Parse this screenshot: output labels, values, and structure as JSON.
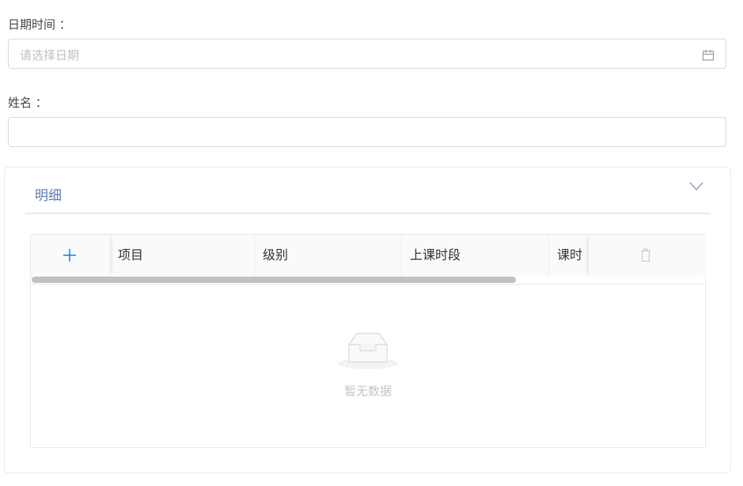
{
  "form": {
    "date_label": "日期时间 ：",
    "date_placeholder": "请选择日期",
    "name_label": "姓名 ：",
    "name_value": ""
  },
  "detail_panel": {
    "title": "明细",
    "columns": [
      "项目",
      "级别",
      "上课时段",
      "课时"
    ],
    "empty_text": "暂无数据",
    "scroll_fraction": 0.72
  },
  "icons": {
    "date": "calendar-icon",
    "toggle": "chevron-down-icon",
    "add": "plus-icon",
    "delete": "trash-icon",
    "empty": "empty-inbox-icon"
  },
  "colors": {
    "accent": "#1e88e5",
    "panel_title": "#5b7bb5",
    "border": "#d9d9d9",
    "placeholder": "#bfbfbf"
  }
}
